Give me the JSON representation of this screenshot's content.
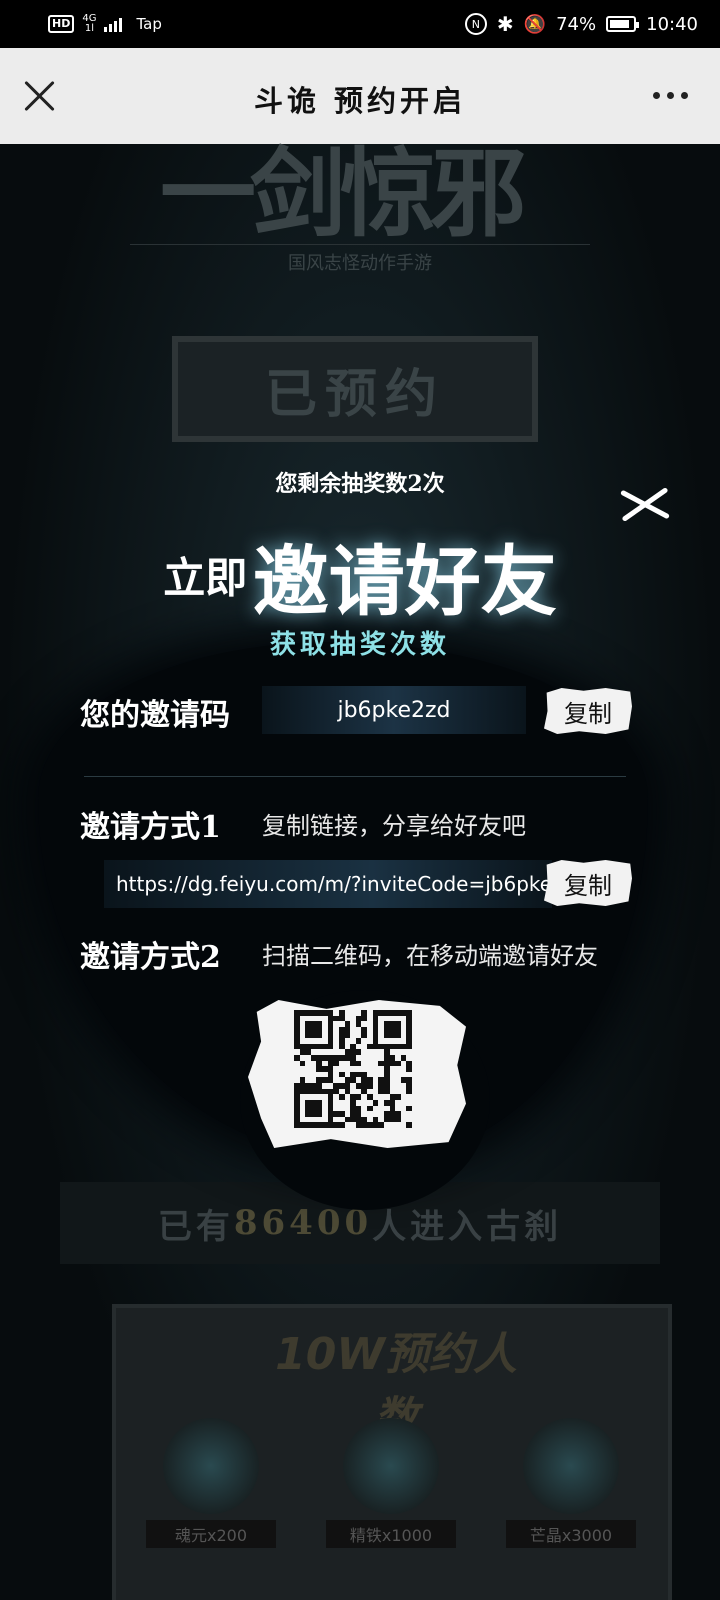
{
  "status_bar": {
    "hd": "HD",
    "network": "4G",
    "network_sub": "1l",
    "carrier": "Tap",
    "battery_pct": "74%",
    "time": "10:40"
  },
  "title_bar": {
    "title": "斗诡 预约开启",
    "close_icon": "close-icon",
    "more_icon": "more-icon"
  },
  "background": {
    "logo_text": "一剑惊邪",
    "tagline": "国风志怪动作手游",
    "reserved_label": "已预约",
    "counter_prefix": "已有",
    "counter_number": "86400",
    "counter_suffix": "人进入古刹",
    "rewards_title": "10W预约人数",
    "rewards": [
      {
        "label": "魂元x200"
      },
      {
        "label": "精铁x1000"
      },
      {
        "label": "芒晶x3000"
      }
    ]
  },
  "dialog": {
    "remaining": "您剩余抽奖数2次",
    "headline_prefix": "立即",
    "headline_main": "邀请好友",
    "subheadline": "获取抽奖次数",
    "invite_code_label": "您的邀请码",
    "invite_code": "jb6pke2zd",
    "copy_label": "复制",
    "method1_label": "邀请方式1",
    "method1_desc": "复制链接，分享给好友吧",
    "invite_link": "https://dg.feiyu.com/m/?inviteCode=jb6pke2zd",
    "method2_label": "邀请方式2",
    "method2_desc": "扫描二维码，在移动端邀请好友"
  }
}
